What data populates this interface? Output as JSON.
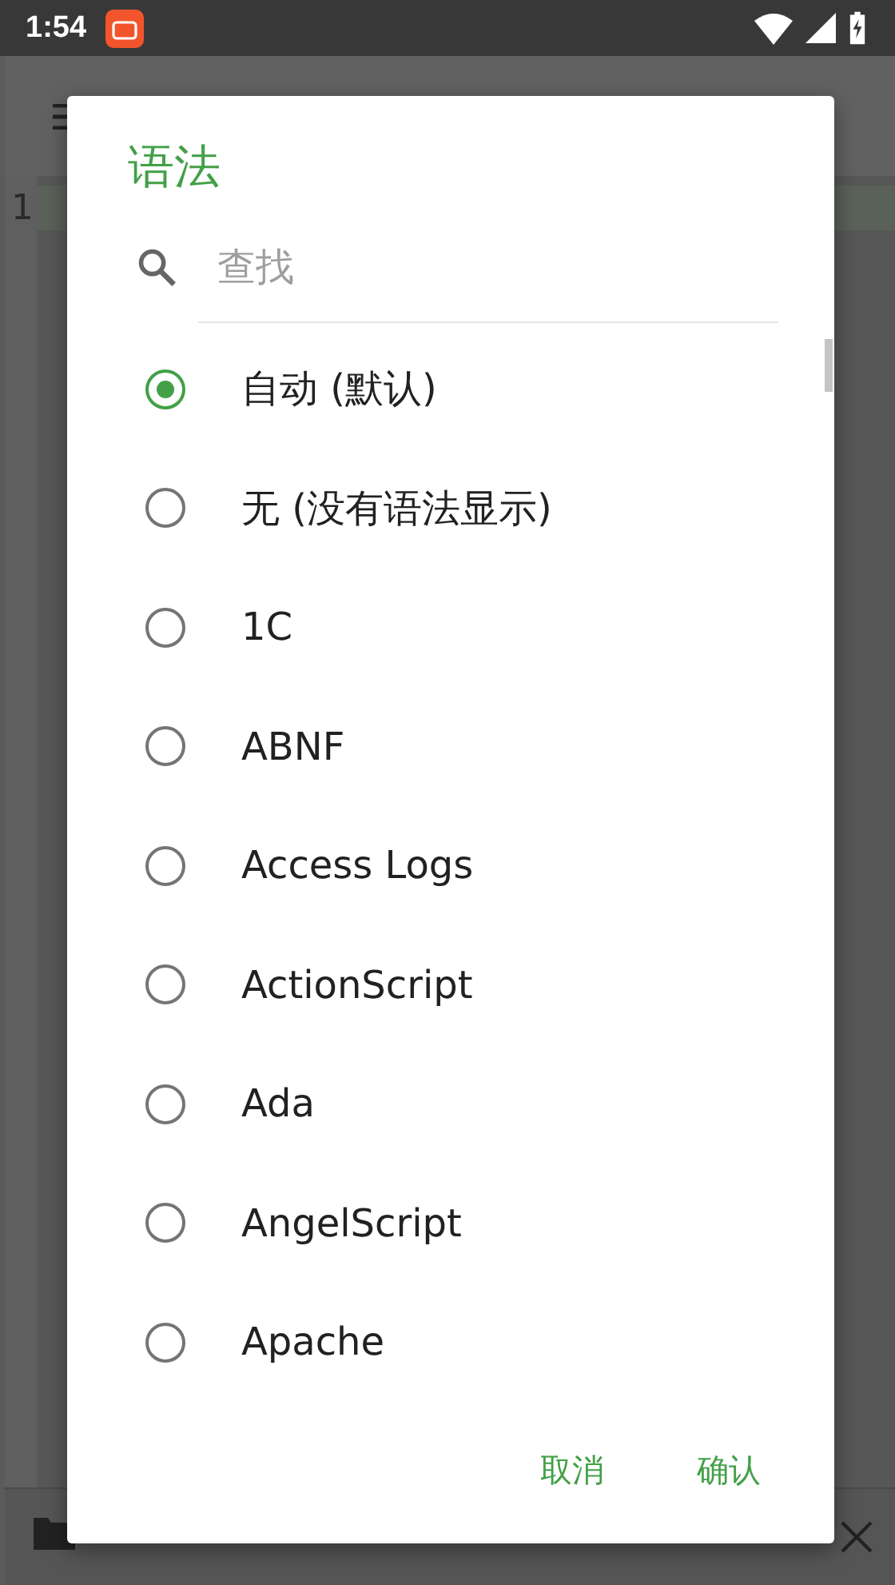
{
  "status_bar": {
    "time": "1:54"
  },
  "editor": {
    "line_number": "1"
  },
  "dialog": {
    "title": "语法",
    "search": {
      "placeholder": "查找"
    },
    "options": [
      {
        "label": "自动 (默认)",
        "selected": true
      },
      {
        "label": "无 (没有语法显示)",
        "selected": false
      },
      {
        "label": "1C",
        "selected": false
      },
      {
        "label": "ABNF",
        "selected": false
      },
      {
        "label": "Access Logs",
        "selected": false
      },
      {
        "label": "ActionScript",
        "selected": false
      },
      {
        "label": "Ada",
        "selected": false
      },
      {
        "label": "AngelScript",
        "selected": false
      },
      {
        "label": "Apache",
        "selected": false
      }
    ],
    "buttons": [
      "取消",
      "确认"
    ]
  }
}
